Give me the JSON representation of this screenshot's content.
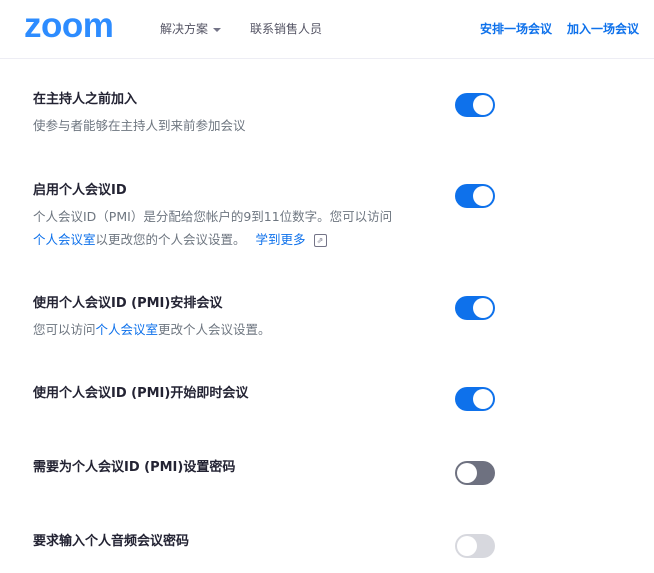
{
  "header": {
    "logo": "zoom",
    "nav": {
      "solutions": "解决方案",
      "sales": "联系销售人员"
    },
    "links": {
      "schedule": "安排一场会议",
      "join": "加入一场会议"
    }
  },
  "settings": [
    {
      "title": "在主持人之前加入",
      "desc": "使参与者能够在主持人到来前参加会议",
      "state": "on"
    },
    {
      "title": "启用个人会议ID",
      "desc_line1": "个人会议ID（PMI）是分配给您帐户的9到11位数字。您可以访问",
      "desc_link": "个人会议室",
      "desc_after": "以更改您的个人会议设置。",
      "learn_more": "学到更多",
      "state": "on"
    },
    {
      "title": "使用个人会议ID (PMI)安排会议",
      "desc_before": "您可以访问",
      "desc_link": "个人会议室",
      "desc_after": "更改个人会议设置。",
      "state": "on"
    },
    {
      "title": "使用个人会议ID (PMI)开始即时会议",
      "state": "on"
    },
    {
      "title": "需要为个人会议ID (PMI)设置密码",
      "state": "off"
    },
    {
      "title": "要求输入个人音频会议密码",
      "state": "disabled"
    }
  ],
  "colors": {
    "accent": "#0e71eb",
    "brand": "#2d8cff",
    "toggle_off": "#6e7180",
    "toggle_disabled": "#d7d8de"
  },
  "icons": {
    "external": "external-link-icon",
    "caret": "chevron-down-icon"
  }
}
